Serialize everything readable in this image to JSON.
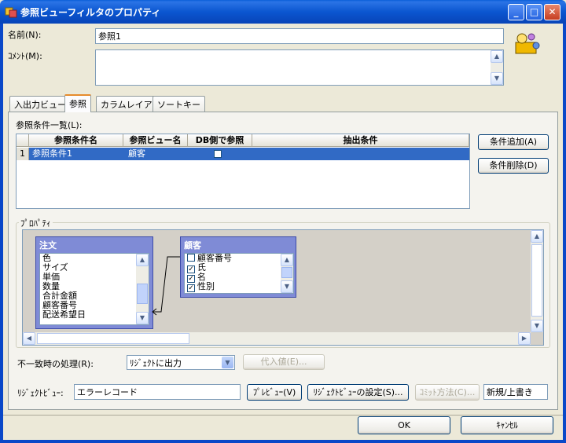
{
  "window": {
    "title": "参照ビューフィルタのプロパティ",
    "min": "_",
    "max": "□",
    "close": "✕"
  },
  "form": {
    "name_label": "名前(N):",
    "name_value": "参照1",
    "comment_label": "ｺﾒﾝﾄ(M):",
    "comment_value": ""
  },
  "tabs": [
    "入出力ビュー",
    "参照",
    "カラムレイアウト",
    "ソートキー"
  ],
  "ref_list": {
    "label": "参照条件一覧(L):",
    "columns": [
      "参照条件名",
      "参照ビュー名",
      "DB側で参照",
      "抽出条件"
    ],
    "rows": [
      {
        "num": "1",
        "name": "参照条件1",
        "view": "顧客",
        "db": "",
        "cond": ""
      }
    ]
  },
  "buttons": {
    "add": "条件追加(A)",
    "delete": "条件削除(D)",
    "subst": "代入値(E)...",
    "preview": "ﾌﾟﾚﾋﾞｭｰ(V)",
    "reject_settings": "ﾘｼﾞｪｸﾄﾋﾞｭｰの設定(S)...",
    "commit": "ｺﾐｯﾄ方法(C)...",
    "ok": "OK",
    "cancel": "ｷｬﾝｾﾙ"
  },
  "properties": {
    "label": "ﾌﾟﾛﾊﾟﾃｨ",
    "table1": {
      "title": "注文",
      "items": [
        "色",
        "サイズ",
        "単価",
        "数量",
        "合計金額",
        "顧客番号",
        "配送希望日"
      ]
    },
    "table2": {
      "title": "顧客",
      "items": [
        {
          "label": "顧客番号",
          "checked": false
        },
        {
          "label": "氏",
          "checked": true
        },
        {
          "label": "名",
          "checked": true
        },
        {
          "label": "性別",
          "checked": true
        }
      ]
    }
  },
  "mismatch": {
    "label": "不一致時の処理(R):",
    "value": "ﾘｼﾞｪｸﾄに出力"
  },
  "reject": {
    "label": "ﾘｼﾞｪｸﾄﾋﾞｭｰ:",
    "value": "エラーレコード",
    "mode": "新規/上書き"
  },
  "colors": {
    "titlebar": "#0a5fd8",
    "selection": "#316ac5",
    "table_header": "#7f8bd6"
  }
}
